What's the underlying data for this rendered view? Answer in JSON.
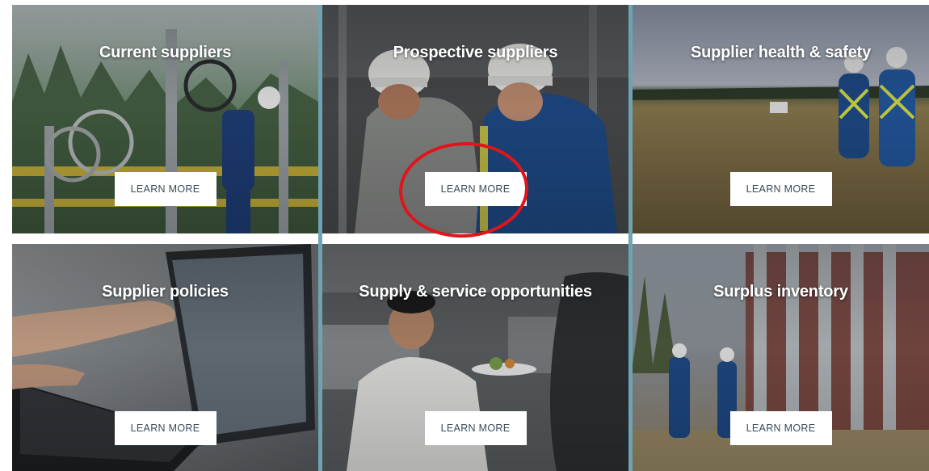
{
  "tiles": [
    {
      "title": "Current suppliers",
      "button": "LEARN MORE"
    },
    {
      "title": "Prospective suppliers",
      "button": "LEARN MORE"
    },
    {
      "title": "Supplier health & safety",
      "button": "LEARN MORE"
    },
    {
      "title": "Supplier policies",
      "button": "LEARN MORE"
    },
    {
      "title": "Supply & service opportunities",
      "button": "LEARN MORE"
    },
    {
      "title": "Surplus inventory",
      "button": "LEARN MORE"
    }
  ],
  "colors": {
    "divider": "#6fa3b3",
    "highlight": "#e0151b",
    "button_text": "#3b4a57"
  }
}
